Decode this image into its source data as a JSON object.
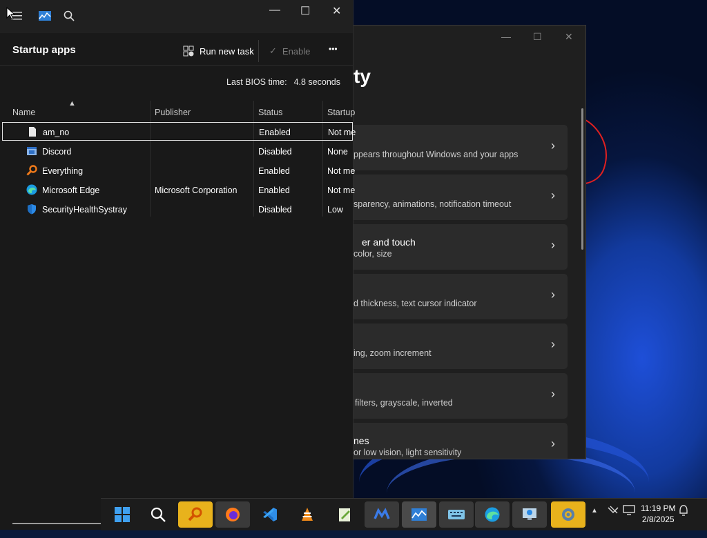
{
  "settings": {
    "title_fragment": "ty",
    "cards": [
      {
        "heading": "",
        "desc": "ppears throughout Windows and your apps"
      },
      {
        "heading": "",
        "desc": "sparency, animations, notification timeout"
      },
      {
        "heading": "er and touch",
        "desc": "color, size"
      },
      {
        "heading": "",
        "desc": "d thickness, text cursor indicator"
      },
      {
        "heading": "",
        "desc": "ing, zoom increment"
      },
      {
        "heading": "",
        "desc": "filters, grayscale, inverted"
      },
      {
        "heading": "nes",
        "desc": "or low vision, light sensitivity"
      }
    ]
  },
  "taskmgr": {
    "page_title": "Startup apps",
    "run_new_task": "Run new task",
    "enable": "Enable",
    "more": "•••",
    "bios_label": "Last BIOS time:",
    "bios_value": "4.8 seconds",
    "columns": {
      "name": "Name",
      "publisher": "Publisher",
      "status": "Status",
      "startup": "Startup"
    },
    "rows": [
      {
        "name": "am_no",
        "publisher": "",
        "status": "Enabled",
        "impact": "Not me"
      },
      {
        "name": "Discord",
        "publisher": "",
        "status": "Disabled",
        "impact": "None"
      },
      {
        "name": "Everything",
        "publisher": "",
        "status": "Enabled",
        "impact": "Not me"
      },
      {
        "name": "Microsoft Edge",
        "publisher": "Microsoft Corporation",
        "status": "Enabled",
        "impact": "Not me"
      },
      {
        "name": "SecurityHealthSystray",
        "publisher": "",
        "status": "Disabled",
        "impact": "Low"
      }
    ]
  },
  "clock": {
    "time": "11:19 PM",
    "date": "2/8/2025"
  }
}
